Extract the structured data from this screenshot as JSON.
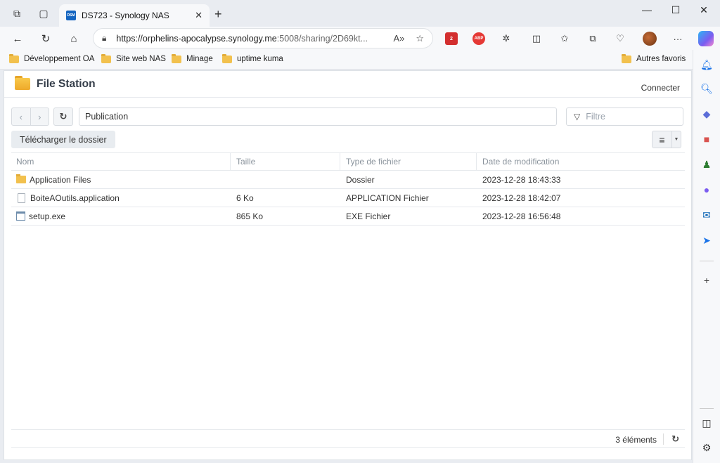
{
  "browser": {
    "tab_title": "DS723 - Synology NAS",
    "tab_favicon": "DSM",
    "url_host": "https://orphelins-apocalypse.synology.me",
    "url_rest": ":5008/sharing/2D69kt...",
    "extension_badge": "2",
    "abp_label": "ABP",
    "bookmarks": [
      "Développement OA",
      "Site web NAS",
      "Minage",
      "uptime kuma"
    ],
    "other_favorites": "Autres favoris"
  },
  "app": {
    "title": "File Station",
    "connect_label": "Connecter",
    "path": "Publication",
    "filter_placeholder": "Filtre",
    "download_label": "Télécharger le dossier",
    "columns": {
      "name": "Nom",
      "size": "Taille",
      "type": "Type de fichier",
      "date": "Date de modification"
    },
    "rows": [
      {
        "name": "Application Files",
        "size": "",
        "type": "Dossier",
        "date": "2023-12-28 18:43:33",
        "icon": "folder-icon"
      },
      {
        "name": "BoiteAOutils.application",
        "size": "6 Ko",
        "type": "APPLICATION Fichier",
        "date": "2023-12-28 18:42:07",
        "icon": "file-icon"
      },
      {
        "name": "setup.exe",
        "size": "865 Ko",
        "type": "EXE Fichier",
        "date": "2023-12-28 16:56:48",
        "icon": "exe-icon"
      }
    ],
    "item_count": "3 éléments"
  },
  "colors": {
    "accent_folder": "#f2c14e",
    "tab_favicon_bg": "#1565c0"
  }
}
